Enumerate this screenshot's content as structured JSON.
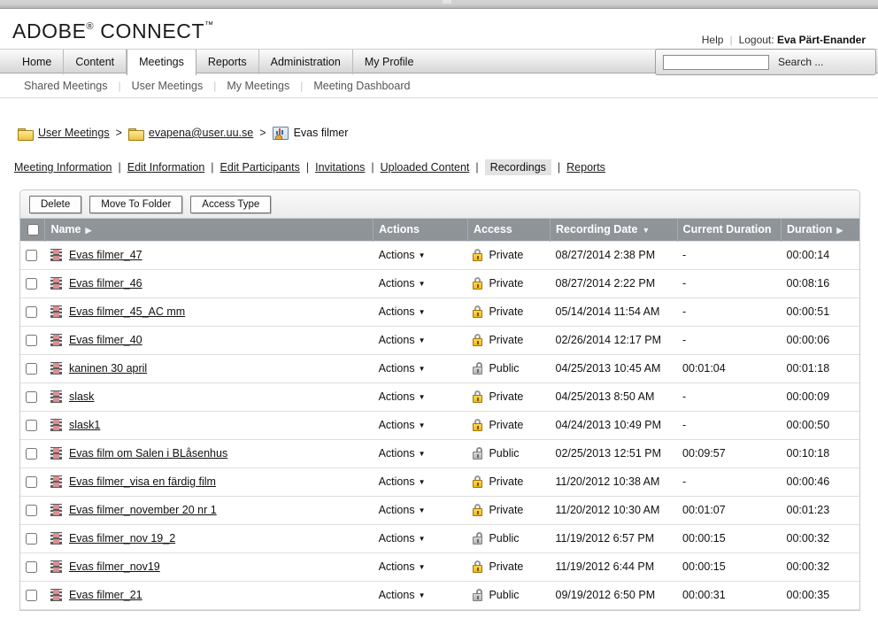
{
  "browser": {
    "chrome_visible": true
  },
  "brand": {
    "name_part1": "ADOBE",
    "registered": "®",
    "name_part2": " CONNECT",
    "trademark": "™"
  },
  "userbar": {
    "help": "Help",
    "separator": "|",
    "logout_label": "Logout:",
    "user_name": "Eva Pärt-Enander"
  },
  "nav": {
    "tabs": [
      {
        "label": "Home",
        "active": false
      },
      {
        "label": "Content",
        "active": false
      },
      {
        "label": "Meetings",
        "active": true
      },
      {
        "label": "Reports",
        "active": false
      },
      {
        "label": "Administration",
        "active": false
      },
      {
        "label": "My Profile",
        "active": false
      }
    ]
  },
  "search": {
    "value": "",
    "placeholder": "",
    "label": "Search ..."
  },
  "subnav": {
    "items": [
      {
        "label": "Shared Meetings"
      },
      {
        "label": "User Meetings"
      },
      {
        "label": "My Meetings"
      },
      {
        "label": "Meeting Dashboard"
      }
    ],
    "separator": "|"
  },
  "breadcrumb": {
    "arrow": ">",
    "items": [
      {
        "label": "User Meetings",
        "icon": "folder-icon",
        "link": true
      },
      {
        "label": "evapena@user.uu.se",
        "icon": "folder-icon",
        "link": true
      },
      {
        "label": "Evas filmer",
        "icon": "meeting-icon",
        "link": false
      }
    ]
  },
  "meeting_tabs": {
    "separator": "|",
    "items": [
      {
        "label": "Meeting Information",
        "active": false
      },
      {
        "label": "Edit Information",
        "active": false
      },
      {
        "label": "Edit Participants",
        "active": false
      },
      {
        "label": "Invitations",
        "active": false
      },
      {
        "label": "Uploaded Content",
        "active": false
      },
      {
        "label": "Recordings",
        "active": true
      },
      {
        "label": "Reports",
        "active": false
      }
    ]
  },
  "toolbar": {
    "delete_label": "Delete",
    "move_to_folder_label": "Move To Folder",
    "access_type_label": "Access Type"
  },
  "table": {
    "columns": [
      {
        "key": "checkbox",
        "label": "",
        "sort": ""
      },
      {
        "key": "name",
        "label": "Name",
        "sort": "▶"
      },
      {
        "key": "actions",
        "label": "Actions",
        "sort": ""
      },
      {
        "key": "access",
        "label": "Access",
        "sort": ""
      },
      {
        "key": "recording_date",
        "label": "Recording Date",
        "sort": "▼"
      },
      {
        "key": "current_duration",
        "label": "Current Duration",
        "sort": ""
      },
      {
        "key": "duration",
        "label": "Duration",
        "sort": "▶"
      }
    ],
    "actions_label": "Actions",
    "actions_caret": "▼",
    "rows": [
      {
        "name": "Evas filmer_47",
        "actions": "Actions",
        "access": "Private",
        "recording_date": "08/27/2014 2:38 PM",
        "current_duration": "-",
        "duration": "00:00:14"
      },
      {
        "name": "Evas filmer_46",
        "actions": "Actions",
        "access": "Private",
        "recording_date": "08/27/2014 2:22 PM",
        "current_duration": "-",
        "duration": "00:08:16"
      },
      {
        "name": "Evas filmer_45_AC mm",
        "actions": "Actions",
        "access": "Private",
        "recording_date": "05/14/2014 11:54 AM",
        "current_duration": "-",
        "duration": "00:00:51"
      },
      {
        "name": "Evas filmer_40",
        "actions": "Actions",
        "access": "Private",
        "recording_date": "02/26/2014 12:17 PM",
        "current_duration": "-",
        "duration": "00:00:06"
      },
      {
        "name": "kaninen 30 april",
        "actions": "Actions",
        "access": "Public",
        "recording_date": "04/25/2013 10:45 AM",
        "current_duration": "00:01:04",
        "duration": "00:01:18"
      },
      {
        "name": "slask",
        "actions": "Actions",
        "access": "Private",
        "recording_date": "04/25/2013 8:50 AM",
        "current_duration": "-",
        "duration": "00:00:09"
      },
      {
        "name": "slask1",
        "actions": "Actions",
        "access": "Private",
        "recording_date": "04/24/2013 10:49 PM",
        "current_duration": "-",
        "duration": "00:00:50"
      },
      {
        "name": "Evas film om Salen i BLåsenhus",
        "actions": "Actions",
        "access": "Public",
        "recording_date": "02/25/2013 12:51 PM",
        "current_duration": "00:09:57",
        "duration": "00:10:18"
      },
      {
        "name": "Evas filmer_visa en färdig film",
        "actions": "Actions",
        "access": "Private",
        "recording_date": "11/20/2012 10:38 AM",
        "current_duration": "-",
        "duration": "00:00:46"
      },
      {
        "name": "Evas filmer_november 20 nr 1",
        "actions": "Actions",
        "access": "Private",
        "recording_date": "11/20/2012 10:30 AM",
        "current_duration": "00:01:07",
        "duration": "00:01:23"
      },
      {
        "name": "Evas filmer_nov 19_2",
        "actions": "Actions",
        "access": "Public",
        "recording_date": "11/19/2012 6:57 PM",
        "current_duration": "00:00:15",
        "duration": "00:00:32"
      },
      {
        "name": "Evas filmer_nov19",
        "actions": "Actions",
        "access": "Private",
        "recording_date": "11/19/2012 6:44 PM",
        "current_duration": "00:00:15",
        "duration": "00:00:32"
      },
      {
        "name": "Evas filmer_21",
        "actions": "Actions",
        "access": "Public",
        "recording_date": "09/19/2012 6:50 PM",
        "current_duration": "00:00:31",
        "duration": "00:00:35"
      }
    ]
  },
  "colors": {
    "header_row_bg": "#8f9499",
    "active_tab_bg": "#ffffff",
    "private_lock": "#f0b81e",
    "public_lock": "#b4b4b4",
    "film_icon": "#d98f93",
    "folder_icon": "#f5d461"
  }
}
